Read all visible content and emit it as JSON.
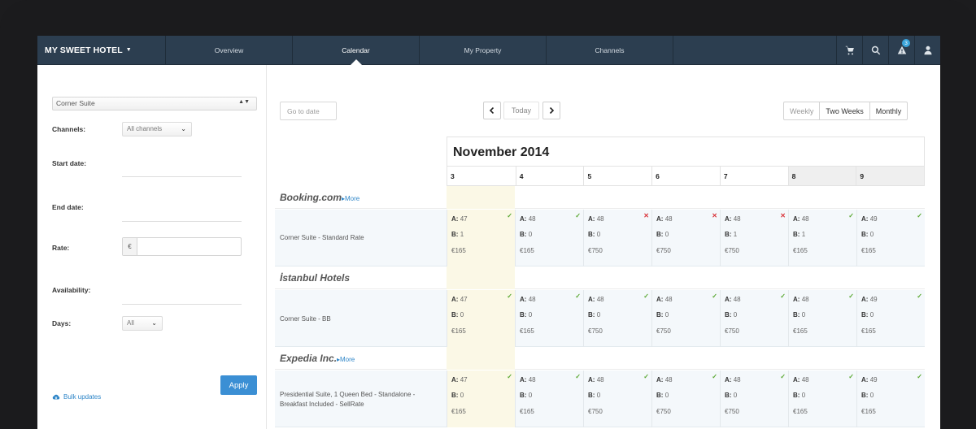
{
  "nav": {
    "brand": "MY SWEET HOTEL",
    "tabs": [
      "Overview",
      "Calendar",
      "My Property",
      "Channels"
    ],
    "active_tab": "Calendar",
    "notification_count": "3"
  },
  "filters": {
    "room_select": "Corner Suite",
    "channels_label": "Channels:",
    "channels_value": "All channels",
    "start_date_label": "Start date:",
    "end_date_label": "End date:",
    "rate_label": "Rate:",
    "currency_symbol": "€",
    "availability_label": "Availability:",
    "days_label": "Days:",
    "days_value": "All",
    "bulk_updates": "Bulk updates",
    "apply": "Apply"
  },
  "toolbar": {
    "goto_placeholder": "Go to date",
    "today": "Today",
    "views": [
      "Weekly",
      "Two Weeks",
      "Monthly"
    ]
  },
  "calendar": {
    "month": "November 2014",
    "days": [
      "3",
      "4",
      "5",
      "6",
      "7",
      "8",
      "9"
    ],
    "weekend_days": [
      "8",
      "9"
    ],
    "colors": {
      "today": "#fbf8e6",
      "ok": "#5aa832",
      "error": "#d9353b",
      "accent": "#3b8fd4"
    },
    "channels": [
      {
        "name": "Booking.com",
        "more": "More",
        "rate_name": "Corner Suite - Standard Rate",
        "cells": [
          {
            "a": "47",
            "b": "1",
            "price": "€165",
            "status": "ok"
          },
          {
            "a": "48",
            "b": "0",
            "price": "€165",
            "status": "ok"
          },
          {
            "a": "48",
            "b": "0",
            "price": "€750",
            "status": "error"
          },
          {
            "a": "48",
            "b": "0",
            "price": "€750",
            "status": "error"
          },
          {
            "a": "48",
            "b": "1",
            "price": "€750",
            "status": "error"
          },
          {
            "a": "48",
            "b": "1",
            "price": "€165",
            "status": "ok"
          },
          {
            "a": "49",
            "b": "0",
            "price": "€165",
            "status": "ok"
          }
        ]
      },
      {
        "name": "İstanbul Hotels",
        "more": "",
        "rate_name": "Corner Suite - BB",
        "cells": [
          {
            "a": "47",
            "b": "0",
            "price": "€165",
            "status": "ok"
          },
          {
            "a": "48",
            "b": "0",
            "price": "€165",
            "status": "ok"
          },
          {
            "a": "48",
            "b": "0",
            "price": "€750",
            "status": "ok"
          },
          {
            "a": "48",
            "b": "0",
            "price": "€750",
            "status": "ok"
          },
          {
            "a": "48",
            "b": "0",
            "price": "€750",
            "status": "ok"
          },
          {
            "a": "48",
            "b": "0",
            "price": "€165",
            "status": "ok"
          },
          {
            "a": "49",
            "b": "0",
            "price": "€165",
            "status": "ok"
          }
        ]
      },
      {
        "name": "Expedia Inc.",
        "more": "More",
        "rate_name": "Presidential Suite, 1 Queen Bed - Standalone - Breakfast Included - SellRate",
        "cells": [
          {
            "a": "47",
            "b": "0",
            "price": "€165",
            "status": "ok"
          },
          {
            "a": "48",
            "b": "0",
            "price": "€165",
            "status": "ok"
          },
          {
            "a": "48",
            "b": "0",
            "price": "€750",
            "status": "ok"
          },
          {
            "a": "48",
            "b": "0",
            "price": "€750",
            "status": "ok"
          },
          {
            "a": "48",
            "b": "0",
            "price": "€750",
            "status": "ok"
          },
          {
            "a": "48",
            "b": "0",
            "price": "€165",
            "status": "ok"
          },
          {
            "a": "49",
            "b": "0",
            "price": "€165",
            "status": "ok"
          }
        ]
      }
    ],
    "cell_labels": {
      "a": "A:",
      "b": "B:"
    }
  }
}
